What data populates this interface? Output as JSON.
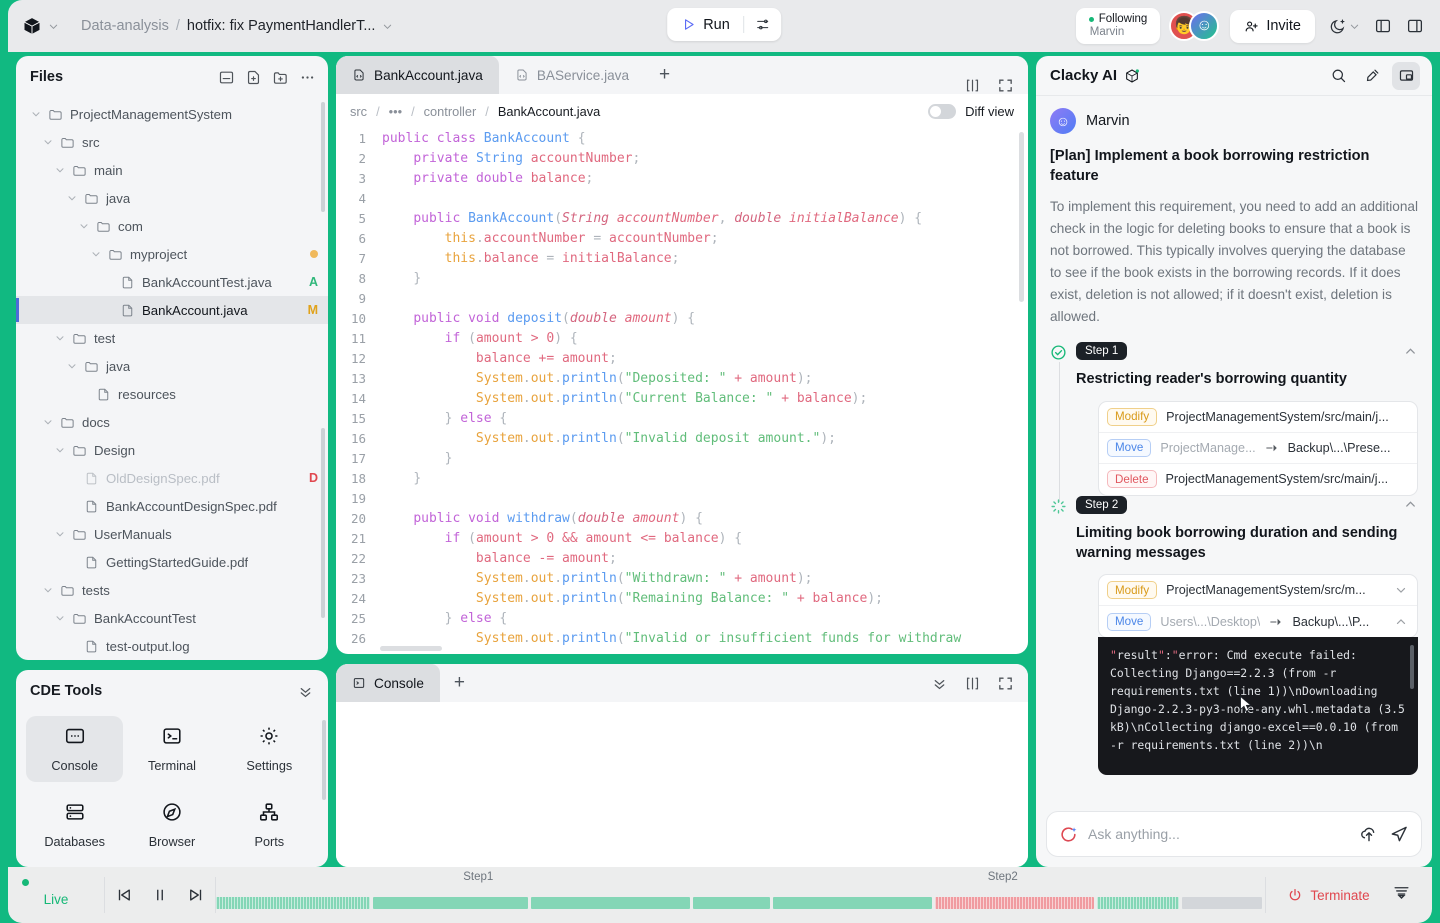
{
  "topbar": {
    "project": "Data-analysis",
    "separator": "/",
    "branch": "hotfix: fix PaymentHandlerT...",
    "run_label": "Run",
    "following_label": "Following",
    "following_user": "Marvin",
    "invite_label": "Invite"
  },
  "files": {
    "title": "Files",
    "tree": [
      {
        "label": "ProjectManagementSystem",
        "depth": 0,
        "type": "folder",
        "state": "open"
      },
      {
        "label": "src",
        "depth": 1,
        "type": "folder",
        "state": "open"
      },
      {
        "label": "main",
        "depth": 2,
        "type": "folder",
        "state": "open"
      },
      {
        "label": "java",
        "depth": 3,
        "type": "folder",
        "state": "open"
      },
      {
        "label": "com",
        "depth": 4,
        "type": "folder",
        "state": "open"
      },
      {
        "label": "myproject",
        "depth": 5,
        "type": "folder",
        "state": "open",
        "dot": true
      },
      {
        "label": "BankAccountTest.java",
        "depth": 6,
        "type": "file",
        "badge": "A",
        "badge_color": "#2fb77a"
      },
      {
        "label": "BankAccount.java",
        "depth": 6,
        "type": "file",
        "badge": "M",
        "badge_color": "#e0a21b",
        "selected": true
      },
      {
        "label": "test",
        "depth": 2,
        "type": "folder",
        "state": "open"
      },
      {
        "label": "java",
        "depth": 3,
        "type": "folder",
        "state": "open"
      },
      {
        "label": "resources",
        "depth": 4,
        "type": "file"
      },
      {
        "label": "docs",
        "depth": 1,
        "type": "folder",
        "state": "open"
      },
      {
        "label": "Design",
        "depth": 2,
        "type": "folder",
        "state": "open"
      },
      {
        "label": "OldDesignSpec.pdf",
        "depth": 3,
        "type": "file",
        "badge": "D",
        "badge_color": "#e0474f",
        "dimmed": true
      },
      {
        "label": "BankAccountDesignSpec.pdf",
        "depth": 3,
        "type": "file"
      },
      {
        "label": "UserManuals",
        "depth": 2,
        "type": "folder",
        "state": "open"
      },
      {
        "label": "GettingStartedGuide.pdf",
        "depth": 3,
        "type": "file"
      },
      {
        "label": "tests",
        "depth": 1,
        "type": "folder",
        "state": "open"
      },
      {
        "label": "BankAccountTest",
        "depth": 2,
        "type": "folder",
        "state": "open"
      },
      {
        "label": "test-output.log",
        "depth": 3,
        "type": "file"
      }
    ]
  },
  "cde_tools": {
    "title": "CDE Tools",
    "items": [
      {
        "label": "Console",
        "icon": "console-icon",
        "active": true
      },
      {
        "label": "Terminal",
        "icon": "terminal-icon",
        "active": false
      },
      {
        "label": "Settings",
        "icon": "gear-icon",
        "active": false
      },
      {
        "label": "Databases",
        "icon": "database-icon",
        "active": false
      },
      {
        "label": "Browser",
        "icon": "compass-icon",
        "active": false
      },
      {
        "label": "Ports",
        "icon": "ports-icon",
        "active": false
      }
    ]
  },
  "editor": {
    "tabs": [
      {
        "label": "BankAccount.java",
        "active": true
      },
      {
        "label": "BAService.java",
        "active": false
      }
    ],
    "add_tab": "+",
    "breadcrumb": [
      "src",
      "/",
      "•••",
      "/",
      "controller",
      "/",
      "BankAccount.java"
    ],
    "diff_view_label": "Diff view",
    "diff_view_on": false,
    "code_lines": [
      {
        "n": 1,
        "html": "<span class='k'>public</span> <span class='k'>class</span> <span class='ty'>BankAccount</span> <span class='pn'>{</span>"
      },
      {
        "n": 2,
        "html": "    <span class='k'>private</span> <span class='ty'>String</span> <span class='id'>accountNumber</span><span class='pn'>;</span>"
      },
      {
        "n": 3,
        "html": "    <span class='k'>private</span> <span class='k'>double</span> <span class='id'>balance</span><span class='pn'>;</span>"
      },
      {
        "n": 4,
        "html": ""
      },
      {
        "n": 5,
        "html": "    <span class='k'>public</span> <span class='ty'>BankAccount</span><span class='pn'>(</span><span class='ity'>String</span> <span class='it'>accountNumber</span><span class='pn'>,</span> <span class='ity'>double</span> <span class='it'>initialBalance</span><span class='pn'>)</span> <span class='pn'>{</span>"
      },
      {
        "n": 6,
        "html": "        <span class='sys'>this</span><span class='pn'>.</span><span class='id'>accountNumber</span> <span class='pn'>=</span> <span class='id'>accountNumber</span><span class='pn'>;</span>"
      },
      {
        "n": 7,
        "html": "        <span class='sys'>this</span><span class='pn'>.</span><span class='id'>balance</span> <span class='pn'>=</span> <span class='id'>initialBalance</span><span class='pn'>;</span>"
      },
      {
        "n": 8,
        "html": "    <span class='pn'>}</span>"
      },
      {
        "n": 9,
        "html": ""
      },
      {
        "n": 10,
        "html": "    <span class='k'>public</span> <span class='k'>void</span> <span class='fn'>deposit</span><span class='pn'>(</span><span class='ity'>double</span> <span class='it'>amount</span><span class='pn'>)</span> <span class='pn'>{</span>"
      },
      {
        "n": 11,
        "html": "        <span class='k'>if</span> <span class='pn'>(</span><span class='id'>amount</span> <span class='op'>&gt;</span> <span class='num'>0</span><span class='pn'>)</span> <span class='pn'>{</span>"
      },
      {
        "n": 12,
        "html": "            <span class='id'>balance</span> <span class='op'>+=</span> <span class='id'>amount</span><span class='pn'>;</span>"
      },
      {
        "n": 13,
        "html": "            <span class='sys'>System</span><span class='pn'>.</span><span class='sys'>out</span><span class='pn'>.</span><span class='fn'>println</span><span class='pn'>(</span><span class='st'>\"Deposited: \"</span> <span class='op'>+</span> <span class='id'>amount</span><span class='pn'>);</span>"
      },
      {
        "n": 14,
        "html": "            <span class='sys'>System</span><span class='pn'>.</span><span class='sys'>out</span><span class='pn'>.</span><span class='fn'>println</span><span class='pn'>(</span><span class='st'>\"Current Balance: \"</span> <span class='op'>+</span> <span class='id'>balance</span><span class='pn'>);</span>"
      },
      {
        "n": 15,
        "html": "        <span class='pn'>}</span> <span class='k'>else</span> <span class='pn'>{</span>"
      },
      {
        "n": 16,
        "html": "            <span class='sys'>System</span><span class='pn'>.</span><span class='sys'>out</span><span class='pn'>.</span><span class='fn'>println</span><span class='pn'>(</span><span class='st'>\"Invalid deposit amount.\"</span><span class='pn'>);</span>"
      },
      {
        "n": 17,
        "html": "        <span class='pn'>}</span>"
      },
      {
        "n": 18,
        "html": "    <span class='pn'>}</span>"
      },
      {
        "n": 19,
        "html": ""
      },
      {
        "n": 20,
        "html": "    <span class='k'>public</span> <span class='k'>void</span> <span class='fn'>withdraw</span><span class='pn'>(</span><span class='ity'>double</span> <span class='it'>amount</span><span class='pn'>)</span> <span class='pn'>{</span>"
      },
      {
        "n": 21,
        "html": "        <span class='k'>if</span> <span class='pn'>(</span><span class='id'>amount</span> <span class='op'>&gt;</span> <span class='num'>0</span> <span class='op'>&amp;&amp;</span> <span class='id'>amount</span> <span class='op'>&lt;=</span> <span class='id'>balance</span><span class='pn'>)</span> <span class='pn'>{</span>"
      },
      {
        "n": 22,
        "html": "            <span class='id'>balance</span> <span class='op'>-=</span> <span class='id'>amount</span><span class='pn'>;</span>"
      },
      {
        "n": 23,
        "html": "            <span class='sys'>System</span><span class='pn'>.</span><span class='sys'>out</span><span class='pn'>.</span><span class='fn'>println</span><span class='pn'>(</span><span class='st'>\"Withdrawn: \"</span> <span class='op'>+</span> <span class='id'>amount</span><span class='pn'>);</span>"
      },
      {
        "n": 24,
        "html": "            <span class='sys'>System</span><span class='pn'>.</span><span class='sys'>out</span><span class='pn'>.</span><span class='fn'>println</span><span class='pn'>(</span><span class='st'>\"Remaining Balance: \"</span> <span class='op'>+</span> <span class='id'>balance</span><span class='pn'>);</span>"
      },
      {
        "n": 25,
        "html": "        <span class='pn'>}</span> <span class='k'>else</span> <span class='pn'>{</span>"
      },
      {
        "n": 26,
        "html": "            <span class='sys'>System</span><span class='pn'>.</span><span class='sys'>out</span><span class='pn'>.</span><span class='fn'>println</span><span class='pn'>(</span><span class='st'>\"Invalid or insufficient funds for withdraw</span>"
      }
    ]
  },
  "console": {
    "tab_label": "Console",
    "add_label": "+"
  },
  "ai": {
    "title": "Clacky AI",
    "author": "Marvin",
    "plan_title": "[Plan] Implement a book borrowing restriction feature",
    "plan_body": "To implement this requirement, you need to add an additional check in the logic for deleting books to ensure that a book is not borrowed. This typically involves querying the database to see if the book exists in the borrowing records. If it does exist, deletion is not allowed; if it doesn't exist, deletion is allowed.",
    "steps": [
      {
        "chip": "Step 1",
        "name": "Restricting reader's borrowing quantity",
        "status": "done",
        "ops": [
          {
            "badge": "Modify",
            "badge_type": "mod",
            "path": "ProjectManagementSystem/src/main/j...",
            "status": "done"
          },
          {
            "badge": "Move",
            "badge_type": "mov",
            "path": "ProjectManage...",
            "path2": "Backup\\...\\Prese...",
            "status": "done"
          },
          {
            "badge": "Delete",
            "badge_type": "del",
            "path": "ProjectManagementSystem/src/main/j...",
            "status": "done"
          }
        ]
      },
      {
        "chip": "Step 2",
        "name": "Limiting book borrowing duration and sending warning messages",
        "status": "running",
        "ops": [
          {
            "badge": "Modify",
            "badge_type": "mod",
            "path": "ProjectManagementSystem/src/m...",
            "status": "done",
            "chevron": "down"
          },
          {
            "badge": "Move",
            "badge_type": "mov",
            "path": "Users\\...\\Desktop\\",
            "path2": "Backup\\...\\P...",
            "status": "error",
            "chevron": "up"
          }
        ],
        "terminal": "\"result\":\"error: Cmd execute failed: Collecting Django==2.2.3 (from -r requirements.txt (line 1))\\nDownloading Django-2.2.3-py3-none-any.whl.metadata (3.5 kB)\\nCollecting django-excel==0.0.10 (from -r requirements.txt (line 2))\\n"
      }
    ],
    "input_placeholder": "Ask anything..."
  },
  "bottombar": {
    "live_label": "Live",
    "step1_label": "Step1",
    "step2_label": "Step2",
    "terminate_label": "Terminate"
  },
  "colors": {
    "accent_green": "#11b981",
    "danger_red": "#e0474f",
    "modify_yellow": "#d99b1b",
    "move_blue": "#4b86e8"
  }
}
